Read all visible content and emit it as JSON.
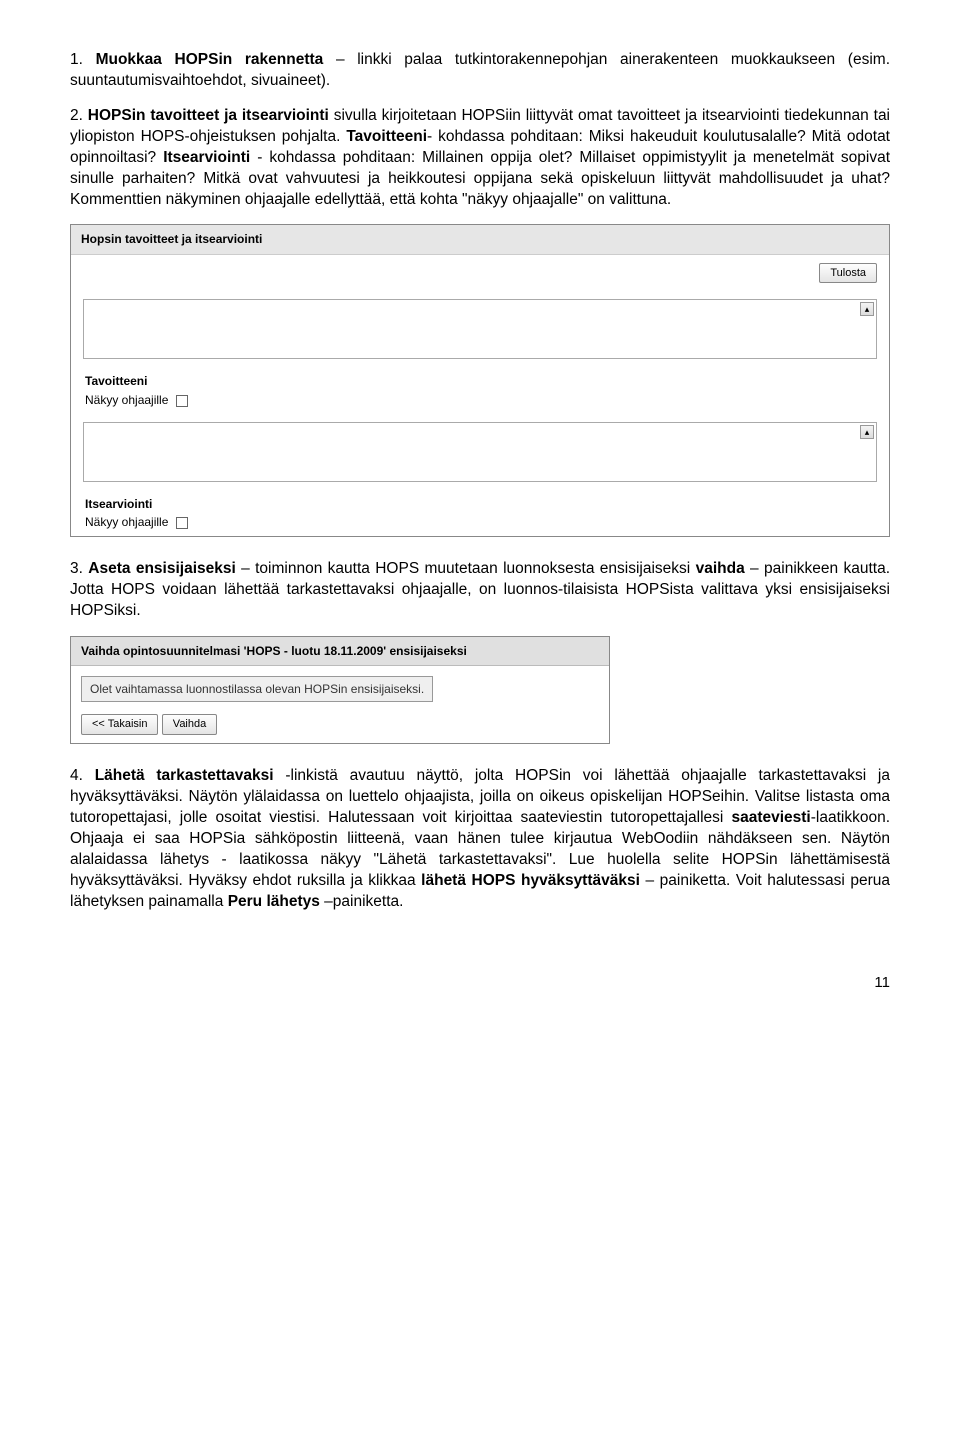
{
  "para1_pre": "1. ",
  "para1_b": "Muokkaa HOPSin rakennetta",
  "para1_post": " – linkki palaa tutkintorakennepohjan ainerakenteen muokkaukseen (esim. suuntautumisvaihtoehdot, sivuaineet).",
  "para2_pre": "2. ",
  "para2_b1": "HOPSin tavoitteet ja itsearviointi",
  "para2_t1": " sivulla kirjoitetaan HOPSiin liittyvät omat tavoitteet ja itsearviointi tiedekunnan tai yliopiston HOPS-ohjeistuksen pohjalta. ",
  "para2_b2": "Tavoitteeni",
  "para2_t2": "- kohdassa pohditaan: Miksi hakeuduit koulutusalalle? Mitä odotat opinnoiltasi? ",
  "para2_b3": "Itsearviointi",
  "para2_t3": " - kohdassa pohditaan: Millainen oppija olet? Millaiset oppimistyylit ja menetelmät sopivat sinulle parhaiten? Mitkä ovat vahvuutesi ja heikkoutesi oppijana sekä opiskeluun liittyvät mahdollisuudet ja uhat? Kommenttien näkyminen ohjaajalle edellyttää, että kohta \"näkyy ohjaajalle\" on valittuna.",
  "shot1": {
    "title": "Hopsin tavoitteet ja itsearviointi",
    "printBtn": "Tulosta",
    "sec1": "Tavoitteeni",
    "sec1chk": "Näkyy ohjaajille",
    "sec2": "Itsearviointi",
    "sec2chk": "Näkyy ohjaajille"
  },
  "para3_pre": "3. ",
  "para3_b1": "Aseta ensisijaiseksi",
  "para3_t1": " – toiminnon kautta HOPS muutetaan luonnoksesta ensisijaiseksi ",
  "para3_b2": "vaihda",
  "para3_t2": " – painikkeen kautta.  Jotta HOPS voidaan lähettää tarkastettavaksi ohjaajalle, on luonnos-tilaisista HOPSista valittava yksi ensisijaiseksi HOPSiksi.",
  "shot2": {
    "title": "Vaihda opintosuunnitelmasi 'HOPS - luotu 18.11.2009' ensisijaiseksi",
    "info": "Olet vaihtamassa luonnostilassa olevan HOPSin ensisijaiseksi.",
    "backBtn": "<< Takaisin",
    "changeBtn": "Vaihda"
  },
  "para4_pre": "4. ",
  "para4_b1": "Lähetä tarkastettavaksi",
  "para4_t1": " -linkistä avautuu näyttö, jolta HOPSin voi lähettää ohjaajalle tarkastettavaksi ja hyväksyttäväksi. Näytön ylälaidassa on luettelo ohjaajista, joilla on oikeus opiskelijan HOPSeihin. Valitse listasta oma tutoropettajasi, jolle osoitat viestisi. Halutessaan voit kirjoittaa saateviestin tutoropettajallesi ",
  "para4_b2": "saateviesti",
  "para4_t2": "-laatikkoon. Ohjaaja ei saa HOPSia sähköpostin liitteenä, vaan hänen tulee kirjautua WebOodiin nähdäkseen sen. Näytön alalaidassa lähetys - laatikossa näkyy \"Lähetä tarkastettavaksi\". Lue huolella selite HOPSin lähettämisestä hyväksyttäväksi. Hyväksy ehdot ruksilla ja klikkaa ",
  "para4_b3": "lähetä HOPS hyväksyttäväksi",
  "para4_t3": " – painiketta. Voit halutessasi perua lähetyksen painamalla ",
  "para4_b4": "Peru lähetys",
  "para4_t4": " –painiketta.",
  "pageNum": "11"
}
